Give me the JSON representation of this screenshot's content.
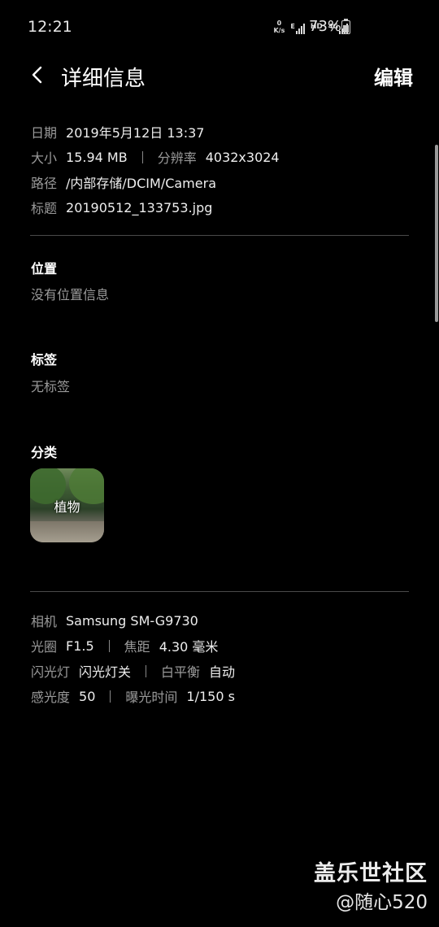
{
  "status_bar": {
    "time": "12:21",
    "net_speed_value": "0",
    "net_speed_unit": "K/s",
    "signal1_tag": "E",
    "hd_tag": "HD",
    "signal2_tag": "4G",
    "battery_text": "73%",
    "battery_level": 0.73
  },
  "header": {
    "title": "详细信息",
    "edit_label": "编辑"
  },
  "file_info": {
    "date_label": "日期",
    "date_value": "2019年5月12日 13:37",
    "size_label": "大小",
    "size_value": "15.94 MB",
    "resolution_label": "分辨率",
    "resolution_value": "4032x3024",
    "path_label": "路径",
    "path_value": "/内部存储/DCIM/Camera",
    "name_label": "标题",
    "name_value": "20190512_133753.jpg"
  },
  "location": {
    "title": "位置",
    "value": "没有位置信息"
  },
  "tags": {
    "title": "标签",
    "value": "无标签"
  },
  "category": {
    "title": "分类",
    "items": [
      {
        "label": "植物"
      }
    ]
  },
  "camera_info": {
    "camera_label": "相机",
    "camera_value": "Samsung SM-G9730",
    "aperture_label": "光圈",
    "aperture_value": "F1.5",
    "focal_label": "焦距",
    "focal_value": "4.30 毫米",
    "flash_label": "闪光灯",
    "flash_value": "闪光灯关",
    "wb_label": "白平衡",
    "wb_value": "自动",
    "iso_label": "感光度",
    "iso_value": "50",
    "exposure_label": "曝光时间",
    "exposure_value": "1/150 s"
  },
  "watermark": {
    "title": "盖乐世社区",
    "user": "@随心520"
  }
}
